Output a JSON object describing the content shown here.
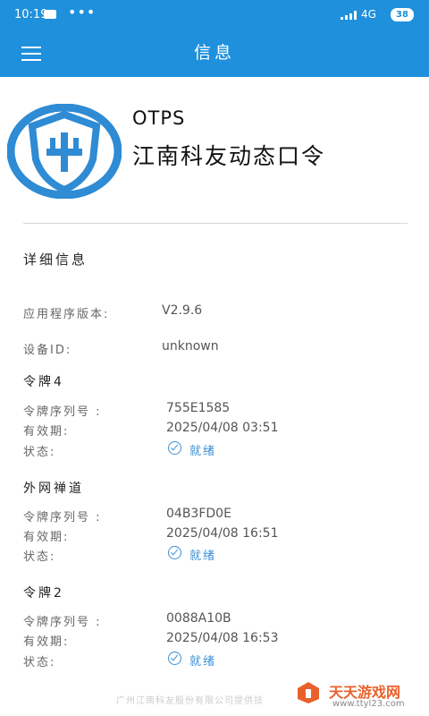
{
  "status_bar": {
    "time": "10:19",
    "network": "4G",
    "battery": "38",
    "icons": [
      "message-icon",
      "more-dots-icon",
      "signal-icon",
      "battery-icon"
    ]
  },
  "toolbar": {
    "title": "信息",
    "menu_icon": "hamburger-menu-icon"
  },
  "app": {
    "logo_icon": "shield-cross-logo",
    "name": "OTPS",
    "subtitle": "江南科友动态口令"
  },
  "details": {
    "section_title": "详细信息",
    "app_version_label": "应用程序版本:",
    "app_version": "V2.9.6",
    "device_id_label": "设备ID:",
    "device_id": "unknown"
  },
  "tokens": [
    {
      "name": "令牌4",
      "serial_label": "令牌序列号 :",
      "serial": "755E1585",
      "expiry_label": "有效期:",
      "expiry": "2025/04/08 03:51",
      "status_label": "状态:",
      "status": "就绪"
    },
    {
      "name": "外网禅道",
      "serial_label": "令牌序列号 :",
      "serial": "04B3FD0E",
      "expiry_label": "有效期:",
      "expiry": "2025/04/08 16:51",
      "status_label": "状态:",
      "status": "就绪"
    },
    {
      "name": "令牌2",
      "serial_label": "令牌序列号 :",
      "serial": "0088A10B",
      "expiry_label": "有效期:",
      "expiry": "2025/04/08 16:53",
      "status_label": "状态:",
      "status": "就绪"
    }
  ],
  "footer": {
    "text": "广州江南科友股份有限公司提供技"
  },
  "watermark": {
    "title": "天天游戏网",
    "url": "www.ttyl23.com"
  },
  "colors": {
    "primary": "#1e90dc",
    "status_ready": "#3a8fd6",
    "watermark": "#e8612c"
  }
}
